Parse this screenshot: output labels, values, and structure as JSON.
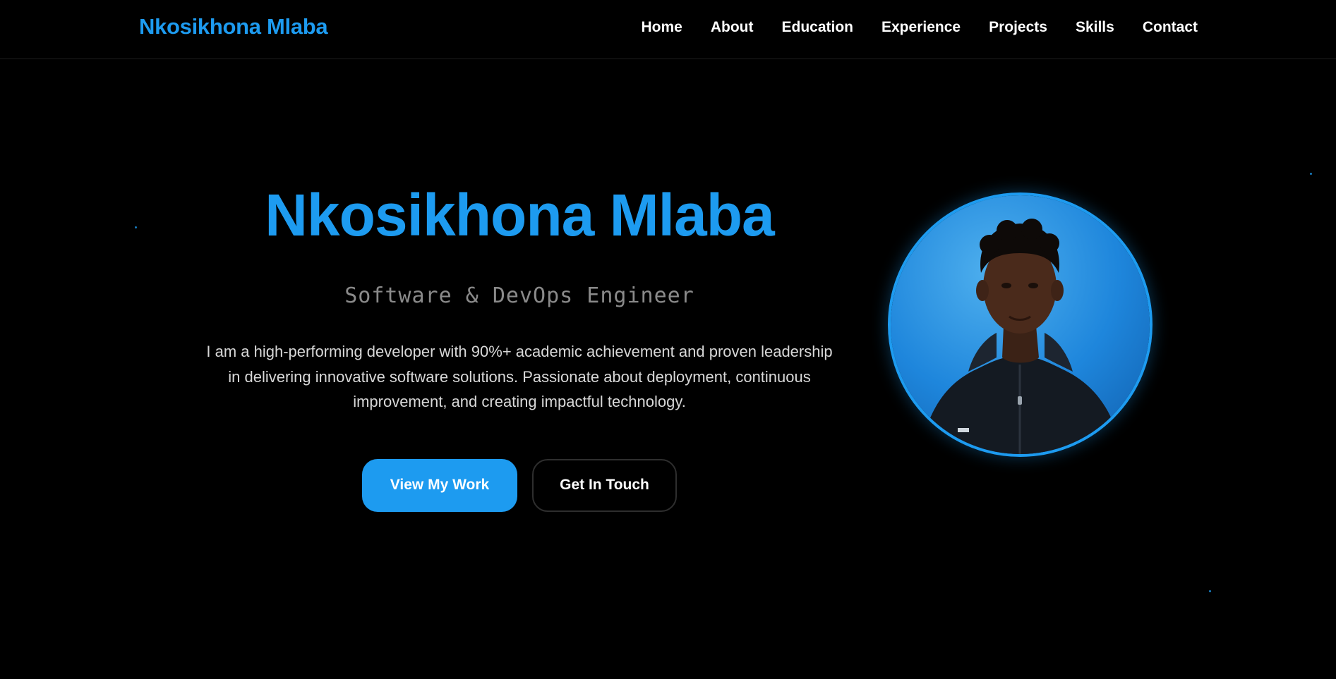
{
  "header": {
    "brand": "Nkosikhona Mlaba",
    "nav": [
      "Home",
      "About",
      "Education",
      "Experience",
      "Projects",
      "Skills",
      "Contact"
    ]
  },
  "hero": {
    "title": "Nkosikhona Mlaba",
    "subtitle": "Software & DevOps Engineer",
    "description": "I am a high-performing developer with 90%+ academic achievement and proven leadership in delivering innovative software solutions. Passionate about deployment, continuous improvement, and creating impactful technology.",
    "primary_button": "View My Work",
    "secondary_button": "Get In Touch"
  },
  "colors": {
    "accent": "#1d9bf0",
    "background": "#000000",
    "muted_text": "#8a8a8a",
    "body_text": "#d8d8d8"
  },
  "icons": {
    "profile_photo": "profile-photo"
  }
}
